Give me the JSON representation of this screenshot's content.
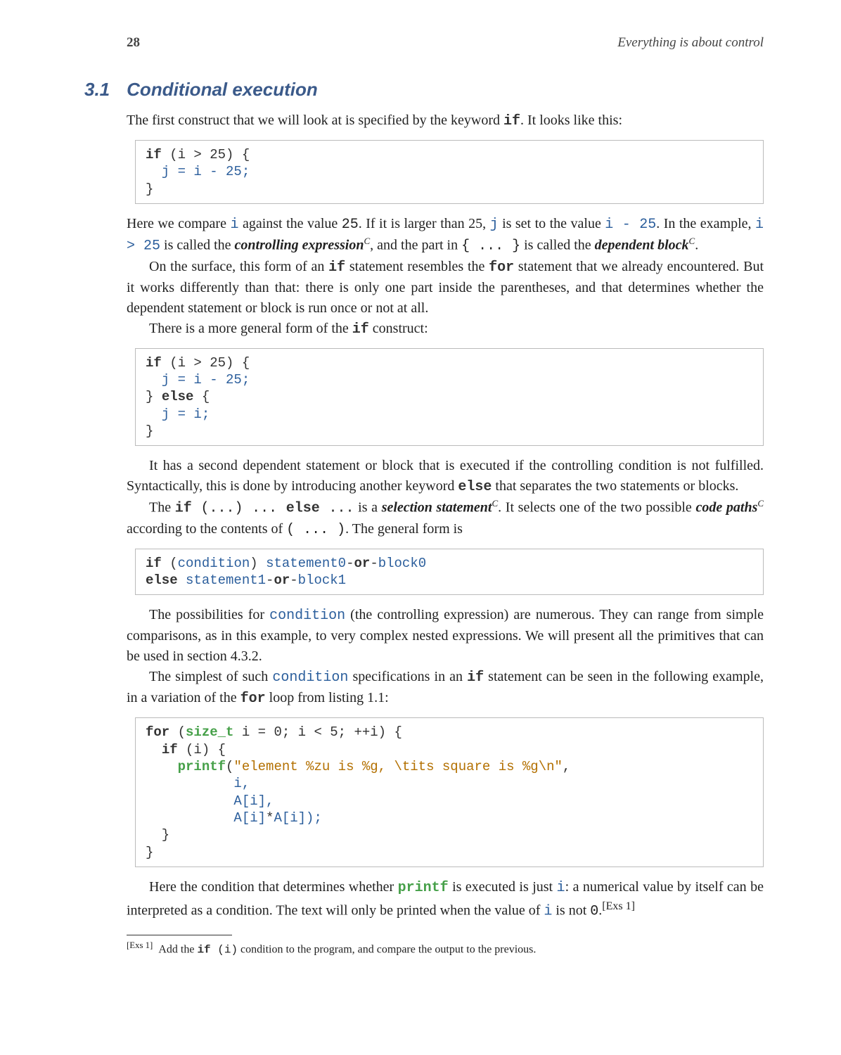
{
  "header": {
    "page_number": "28",
    "chapter": "Everything is about control"
  },
  "section": {
    "number": "3.1",
    "title": "Conditional execution"
  },
  "text": {
    "p1_a": "The first construct that we will look at is specified by the keyword ",
    "p1_kw_if": "if",
    "p1_b": ". It looks like this:",
    "p3_a": "Here we compare ",
    "p3_i1": "i",
    "p3_b": " against the value ",
    "p3_25a": "25",
    "p3_c": ". If it is larger than 25, ",
    "p3_j": "j",
    "p3_d": " is set to the value ",
    "p3_expr": "i - 25",
    "p3_e": ". In the example, ",
    "p3_cond": "i > 25",
    "p3_f": " is called the ",
    "p3_term1": "controlling expression",
    "p3_sup1": "C",
    "p3_g": ", and the part in ",
    "p3_braces": "{ ... }",
    "p3_h": " is called the ",
    "p3_term2": "dependent block",
    "p3_sup2": "C",
    "p3_i": ".",
    "p4_a": "On the surface, this form of an ",
    "p4_if": "if",
    "p4_b": " statement resembles the ",
    "p4_for": "for",
    "p4_c": " statement that we already encountered. But it works differently than that: there is only one part inside the parentheses, and that determines whether the dependent statement or block is run once or not at all.",
    "p5_a": "There is a more general form of the ",
    "p5_if": "if",
    "p5_b": " construct:",
    "p7_a": "It has a second dependent statement or block that is executed if the controlling condition is not fulfilled. Syntactically, this is done by introducing another keyword ",
    "p7_else": "else",
    "p7_b": " that separates the two statements or blocks.",
    "p8_a": "The ",
    "p8_if": "if",
    "p8_paren": " (...) ... ",
    "p8_else": "else",
    "p8_dots": " ...",
    "p8_b": " is a ",
    "p8_term": "selection statement",
    "p8_sup": "C",
    "p8_c": ". It selects one of the two possible ",
    "p8_term2": "code paths",
    "p8_sup2": "C",
    "p8_d": " according to the contents of ",
    "p8_paren2": "( ... )",
    "p8_e": ". The general form is",
    "p10_a": "The possibilities for ",
    "p10_cond": "condition",
    "p10_b": " (the controlling expression) are numerous. They can range from simple comparisons, as in this example, to very complex nested expressions. We will present all the primitives that can be used in section 4.3.2.",
    "p11_a": "The simplest of such ",
    "p11_cond": "condition",
    "p11_b": " specifications in an ",
    "p11_if": "if",
    "p11_c": " statement can be seen in the following example, in a variation of the ",
    "p11_for": "for",
    "p11_d": " loop from listing 1.1:",
    "p13_a": "Here the condition that determines whether ",
    "p13_printf": "printf",
    "p13_b": " is executed is just ",
    "p13_i": "i",
    "p13_c": ": a numerical value by itself can be interpreted as a condition. The text will only be printed when the value of ",
    "p13_i2": "i",
    "p13_d": " is not ",
    "p13_zero": "0",
    "p13_e": ".",
    "p13_fn": "[Exs 1]"
  },
  "code": {
    "block1": {
      "l1_kw": "if",
      "l1_rest": " (i > 25) {",
      "l2": "  j = i - 25;",
      "l3": "}"
    },
    "block2": {
      "l1_kw": "if",
      "l1_rest": " (i > 25) {",
      "l2": "  j = i - 25;",
      "l3a": "} ",
      "l3_kw": "else",
      "l3b": " {",
      "l4": "  j = i;",
      "l5": "}"
    },
    "block3": {
      "l1_kw": "if",
      "l1_a": " (",
      "l1_cond": "condition",
      "l1_b": ") ",
      "l1_s0": "statement0",
      "l1_dash1": "-",
      "l1_or": "or",
      "l1_dash2": "-",
      "l1_b0": "block0",
      "l2_kw": "else",
      "l2_sp": " ",
      "l2_s1": "statement1",
      "l2_dash1": "-",
      "l2_or": "or",
      "l2_dash2": "-",
      "l2_b1": "block1"
    },
    "block4": {
      "l1_for": "for",
      "l1_a": " (",
      "l1_sizet": "size_t",
      "l1_b": " i = 0; i < 5; ++i) {",
      "l2_sp": "  ",
      "l2_if": "if",
      "l2_rest": " (i) {",
      "l3_sp": "    ",
      "l3_printf": "printf",
      "l3_a": "(",
      "l3_str": "\"element %zu is %g, \\tits square is %g\\n\"",
      "l3_b": ",",
      "l4": "           i,",
      "l5": "           A[i],",
      "l6_sp": "           ",
      "l6_a": "A[i]",
      "l6_star": "*",
      "l6_b": "A[i]);",
      "l7": "  }",
      "l8": "}"
    }
  },
  "footnote": {
    "mark": "[Exs 1]",
    "a": "Add the ",
    "if": "if",
    "paren": " (i)",
    "b": " condition to the program, and compare the output to the previous."
  }
}
